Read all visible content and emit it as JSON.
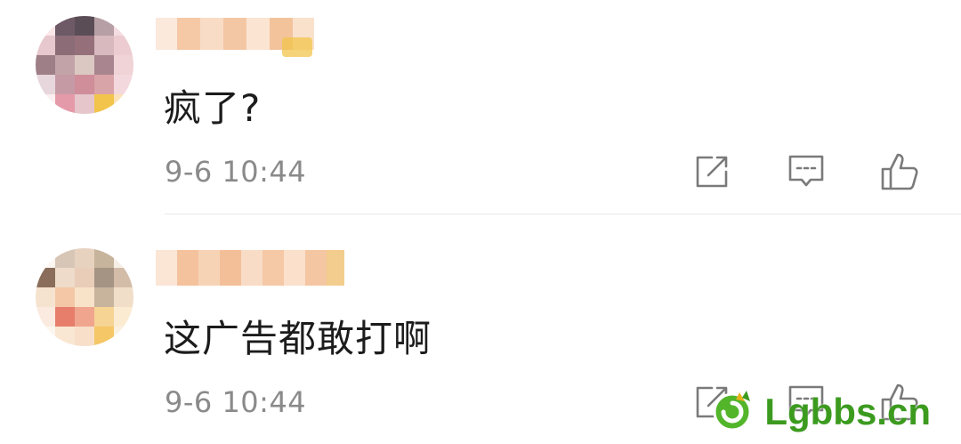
{
  "comments": [
    {
      "text": "疯了?",
      "time": "9-6 10:44"
    },
    {
      "text": "这广告都敢打啊",
      "time": "9-6 10:44"
    }
  ],
  "icons": {
    "share": "share-icon",
    "reply": "comment-icon",
    "like": "thumbs-up-icon"
  },
  "watermark": {
    "text": "Lgbbs.cn"
  },
  "colors": {
    "text": "#1c1c1c",
    "time": "#8a8a8a",
    "icon": "#7a7a7a",
    "divider": "#e8e8e8",
    "watermark": "#3c9b1f"
  }
}
